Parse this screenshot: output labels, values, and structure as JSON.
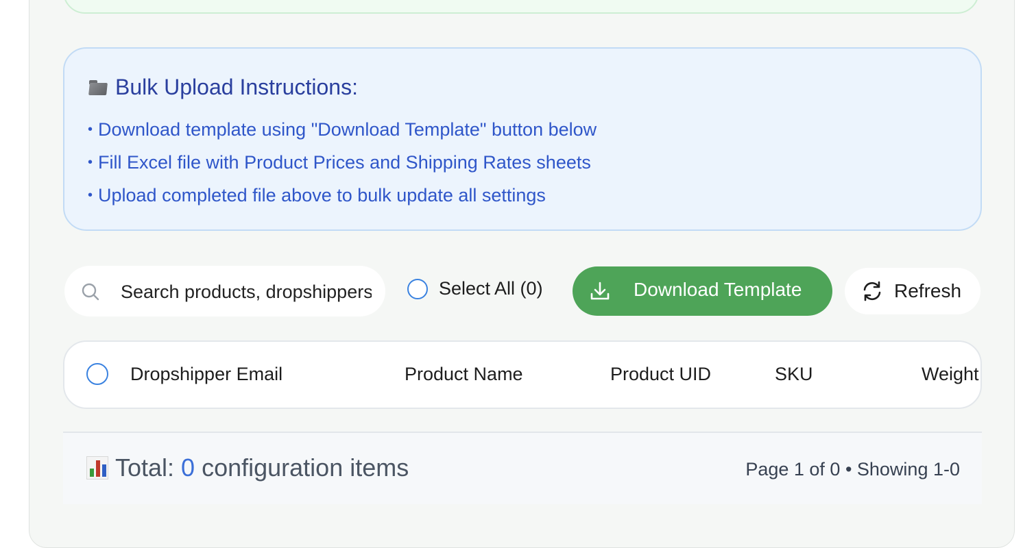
{
  "instructions": {
    "title": "Bulk Upload Instructions:",
    "title_icon": "folder-icon",
    "items": [
      "Download template using \"Download Template\" button below",
      "Fill Excel file with Product Prices and Shipping Rates sheets",
      "Upload completed file above to bulk update all settings"
    ],
    "bullet": "•"
  },
  "toolbar": {
    "search": {
      "placeholder": "Search products, dropshippers...",
      "value": ""
    },
    "select_all_label": "Select All (0)",
    "download_template_label": "Download Template",
    "refresh_label": "Refresh"
  },
  "table": {
    "columns": [
      "Dropshipper Email",
      "Product Name",
      "Product UID",
      "SKU",
      "Weight"
    ]
  },
  "footer": {
    "total_prefix": "Total:",
    "total_count": "0",
    "total_suffix": "configuration items",
    "page_info": "Page 1 of 0 • Showing 1-0"
  },
  "colors": {
    "accent_green": "#4ea458",
    "instructions_text": "#2f56c9",
    "instructions_title": "#2a3f9e",
    "radio_blue": "#3a82e0",
    "count_blue": "#3b6fd8"
  }
}
